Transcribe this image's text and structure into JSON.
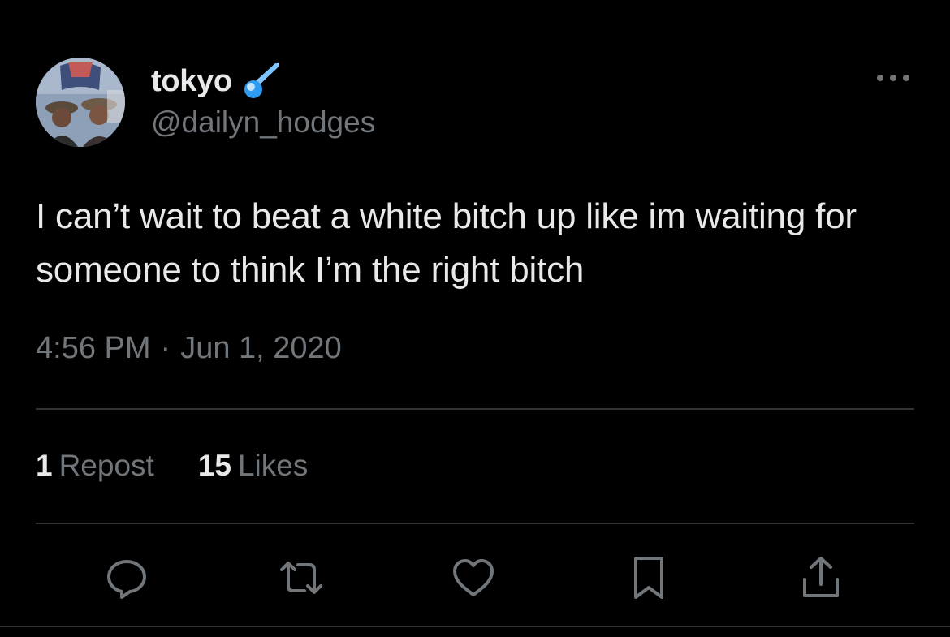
{
  "author": {
    "display_name": "tokyo",
    "handle": "@dailyn_hodges",
    "name_emoji": "comet-icon"
  },
  "tweet": {
    "text": "I can’t wait to beat a white bitch up like im waiting for someone to think I’m the right bitch",
    "time": "4:56 PM",
    "separator": "·",
    "date": "Jun 1, 2020"
  },
  "stats": {
    "reposts_count": "1",
    "reposts_label": "Repost",
    "likes_count": "15",
    "likes_label": "Likes"
  },
  "actions": [
    {
      "name": "reply",
      "icon": "reply-icon"
    },
    {
      "name": "repost",
      "icon": "repost-icon"
    },
    {
      "name": "like",
      "icon": "heart-icon"
    },
    {
      "name": "bookmark",
      "icon": "bookmark-icon"
    },
    {
      "name": "share",
      "icon": "share-icon"
    }
  ],
  "colors": {
    "background": "#000000",
    "primary_text": "#e7e9ea",
    "secondary_text": "#71767b",
    "divider": "#2f3336"
  }
}
